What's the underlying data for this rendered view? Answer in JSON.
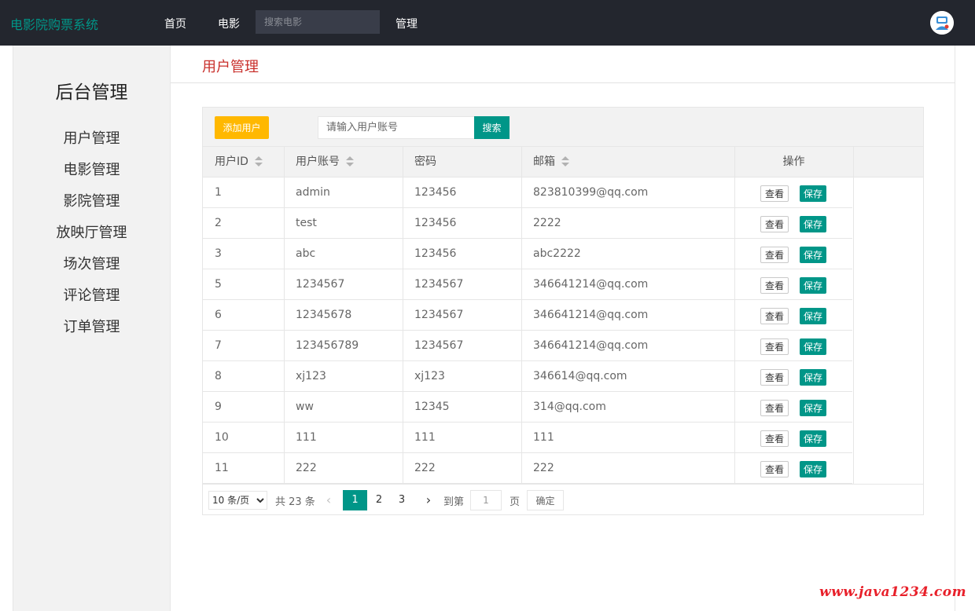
{
  "header": {
    "brand": "电影院购票系统",
    "nav": [
      "首页",
      "电影"
    ],
    "search_placeholder": "搜索电影",
    "manage": "管理"
  },
  "sidebar": {
    "title": "后台管理",
    "items": [
      "用户管理",
      "电影管理",
      "影院管理",
      "放映厅管理",
      "场次管理",
      "评论管理",
      "订单管理"
    ]
  },
  "main": {
    "page_title": "用户管理",
    "add_button": "添加用户",
    "search_placeholder": "请输入用户账号",
    "search_button": "搜索",
    "columns": [
      "用户ID",
      "用户账号",
      "密码",
      "邮箱",
      "操作"
    ],
    "view_label": "查看",
    "save_label": "保存",
    "rows": [
      [
        "1",
        "admin",
        "123456",
        "823810399@qq.com"
      ],
      [
        "2",
        "test",
        "123456",
        "2222"
      ],
      [
        "3",
        "abc",
        "123456",
        "abc2222"
      ],
      [
        "5",
        "1234567",
        "1234567",
        "346641214@qq.com"
      ],
      [
        "6",
        "12345678",
        "1234567",
        "346641214@qq.com"
      ],
      [
        "7",
        "123456789",
        "1234567",
        "346641214@qq.com"
      ],
      [
        "8",
        "xj123",
        "xj123",
        "346614@qq.com"
      ],
      [
        "9",
        "ww",
        "12345",
        "314@qq.com"
      ],
      [
        "10",
        "111",
        "111",
        "111"
      ],
      [
        "11",
        "222",
        "222",
        "222"
      ]
    ]
  },
  "pagination": {
    "page_size": "10 条/页",
    "total": "共 23 条",
    "pages": [
      "1",
      "2",
      "3"
    ],
    "current_page": "1",
    "goto_label": "到第",
    "goto_value": "1",
    "page_unit": "页",
    "confirm": "确定"
  },
  "colors": {
    "accent": "#009688",
    "add_button": "#ffb800",
    "title": "#c9302c",
    "topbar": "#23262e"
  },
  "watermark": "www.java1234.com"
}
